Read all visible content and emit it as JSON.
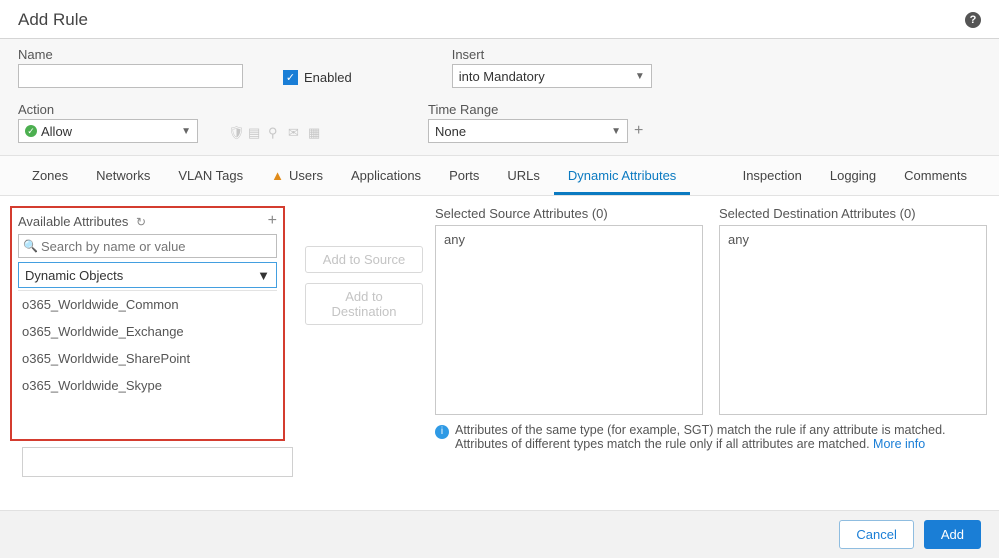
{
  "title": "Add Rule",
  "form": {
    "name_label": "Name",
    "name_value": "",
    "enabled_label": "Enabled",
    "enabled_checked": true,
    "insert_label": "Insert",
    "insert_value": "into Mandatory",
    "action_label": "Action",
    "action_value": "Allow",
    "time_range_label": "Time Range",
    "time_range_value": "None"
  },
  "tabs": {
    "items": [
      "Zones",
      "Networks",
      "VLAN Tags",
      "Users",
      "Applications",
      "Ports",
      "URLs",
      "Dynamic Attributes"
    ],
    "right_items": [
      "Inspection",
      "Logging",
      "Comments"
    ],
    "active": "Dynamic Attributes",
    "users_has_warning": true
  },
  "available": {
    "title": "Available Attributes",
    "search_placeholder": "Search by name or value",
    "filter_value": "Dynamic Objects",
    "options": [
      "o365_Worldwide_Common",
      "o365_Worldwide_Exchange",
      "o365_Worldwide_SharePoint",
      "o365_Worldwide_Skype"
    ]
  },
  "mid_buttons": {
    "add_to_source": "Add to Source",
    "add_to_destination": "Add to Destination"
  },
  "selected_source": {
    "title": "Selected Source Attributes (0)",
    "value": "any"
  },
  "selected_destination": {
    "title": "Selected Destination Attributes (0)",
    "value": "any"
  },
  "hint": {
    "text": "Attributes of the same type (for example, SGT) match the rule if any attribute is matched. Attributes of different types match the rule only if all attributes are matched. ",
    "link": "More info"
  },
  "footer": {
    "cancel": "Cancel",
    "add": "Add"
  }
}
